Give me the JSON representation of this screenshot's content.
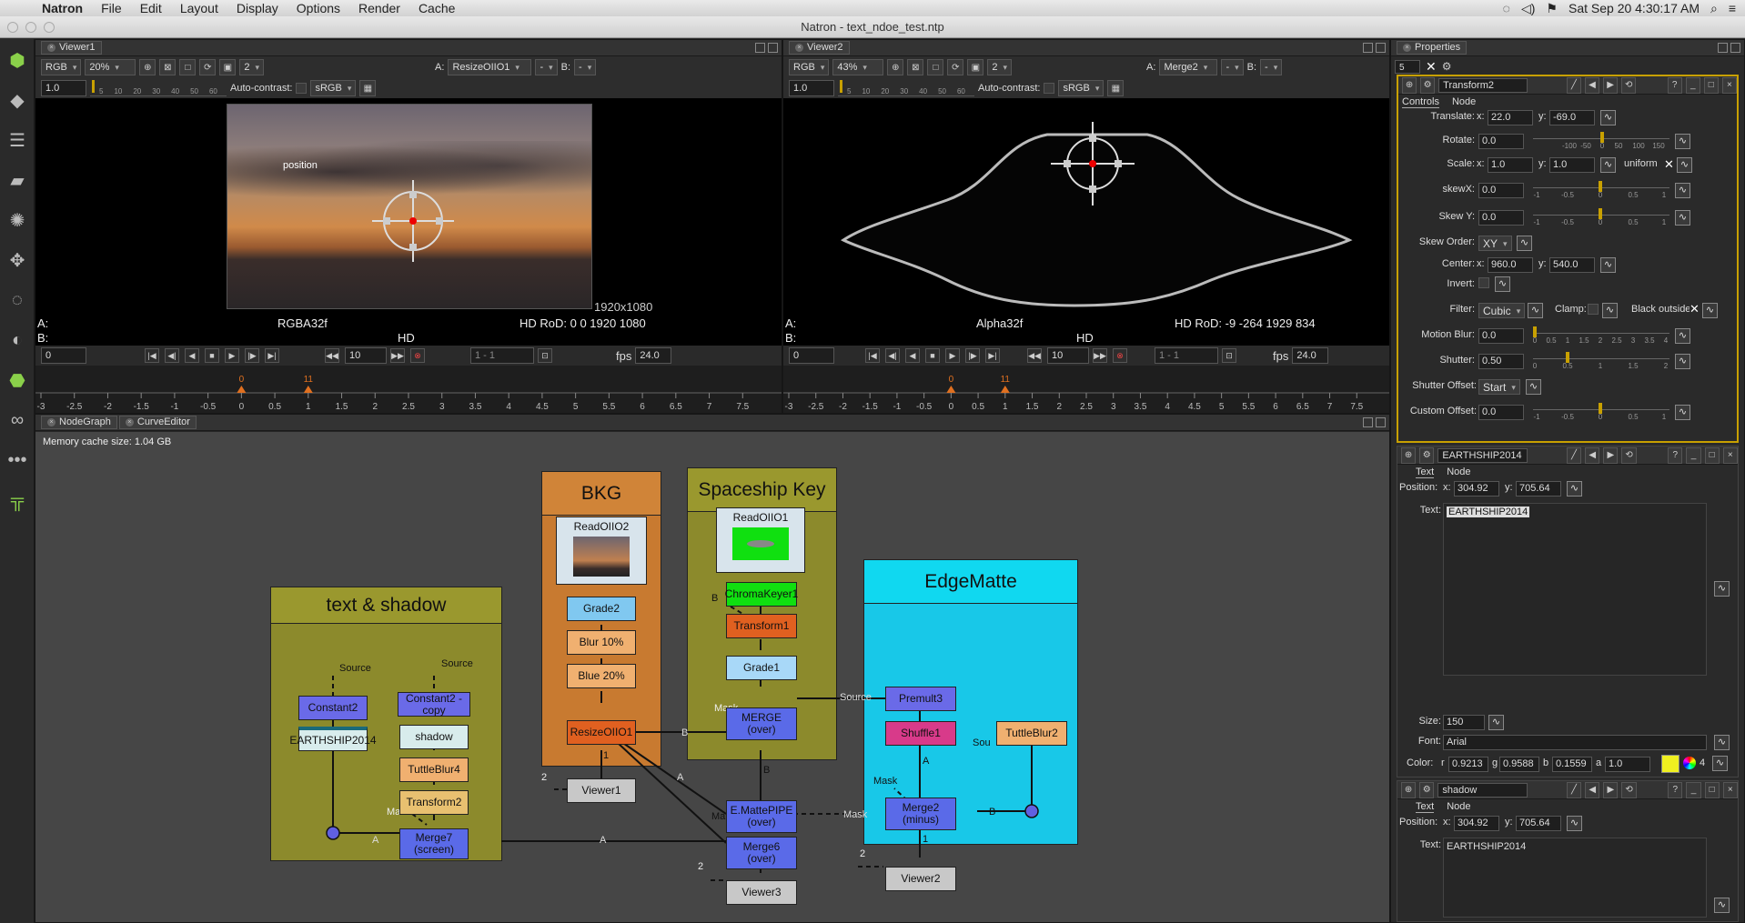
{
  "menubar": {
    "app": "Natron",
    "items": [
      "File",
      "Edit",
      "Layout",
      "Display",
      "Options",
      "Render",
      "Cache"
    ],
    "clock": "Sat Sep 20  4:30:17 AM"
  },
  "window": {
    "title": "Natron - text_ndoe_test.ntp"
  },
  "viewer1": {
    "tab": "Viewer1",
    "channels": "RGB",
    "zoom": "20%",
    "layers": "2",
    "a_label": "A:",
    "a_input": "ResizeOIIO1",
    "a_op": "-",
    "b_label": "B:",
    "b_input": "-",
    "gain": "1.0",
    "autocontrast": "Auto-contrast:",
    "colorspace": "sRGB",
    "gain_ticks": [
      "5",
      "10",
      "20",
      "30",
      "40",
      "50",
      "60"
    ],
    "overlay_text": "position",
    "resolution": "1920x1080",
    "a_info": "A:",
    "b_info": "B:",
    "depth": "RGBA32f",
    "format": "HD",
    "rod": "HD RoD: 0 0 1920 1080",
    "frame": "0",
    "increment": "10",
    "range": "1 - 1",
    "fps_label": "fps",
    "fps": "24.0"
  },
  "viewer2": {
    "tab": "Viewer2",
    "channels": "RGB",
    "zoom": "43%",
    "layers": "2",
    "a_label": "A:",
    "a_input": "Merge2",
    "a_op": "-",
    "b_label": "B:",
    "b_input": "-",
    "gain": "1.0",
    "autocontrast": "Auto-contrast:",
    "colorspace": "sRGB",
    "gain_ticks": [
      "5",
      "10",
      "20",
      "30",
      "40",
      "50",
      "60"
    ],
    "a_info": "A:",
    "b_info": "B:",
    "depth": "Alpha32f",
    "format": "HD",
    "rod": "HD RoD: -9 -264 1929 834",
    "frame": "0",
    "increment": "10",
    "range": "1 - 1",
    "fps_label": "fps",
    "fps": "24.0"
  },
  "timeline": {
    "ticks": [
      "-3",
      "-2.5",
      "-2",
      "-1.5",
      "-1",
      "-0.5",
      "0",
      "0.5",
      "1",
      "1.5",
      "2",
      "2.5",
      "3",
      "3.5",
      "4",
      "4.5",
      "5",
      "5.5",
      "6",
      "6.5",
      "7",
      "7.5"
    ],
    "start": "0",
    "end": "11"
  },
  "nodegraph": {
    "tabs": [
      "NodeGraph",
      "CurveEditor"
    ],
    "cache": "Memory cache size: 1.04 GB",
    "backdrops": {
      "text_shadow": "text & shadow",
      "bkg": "BKG",
      "spaceship": "Spaceship Key",
      "edgematte": "EdgeMatte"
    },
    "nodes": {
      "constant2": "Constant2",
      "earthship": "EARTHSHIP2014",
      "constant2copy": "Constant2 - copy",
      "shadow": "shadow",
      "tuttleblur4": "TuttleBlur4",
      "transform2": "Transform2",
      "merge7": "Merge7\n(screen)",
      "readoiio2": "ReadOIIO2",
      "grade2": "Grade2",
      "blur10": "Blur 10%",
      "blue20": "Blue 20%",
      "resize": "ResizeOIIO1",
      "viewer1": "Viewer1",
      "readoiio1": "ReadOIIO1",
      "chromakeyer": "ChromaKeyer1",
      "transform1": "Transform1",
      "grade1": "Grade1",
      "merge_over": "MERGE\n(over)",
      "emattepipe": "E.MattePIPE\n(over)",
      "merge6": "Merge6\n(over)",
      "viewer3": "Viewer3",
      "premult3": "Premult3",
      "shuffle1": "Shuffle1",
      "tuttleblur2": "TuttleBlur2",
      "merge2": "Merge2\n(minus)",
      "viewer2": "Viewer2"
    },
    "labels": {
      "source": "Source",
      "mask": "Mask",
      "a": "A",
      "b": "B",
      "one": "1",
      "two": "2",
      "ma": "Ma",
      "sou": "Sou"
    }
  },
  "properties": {
    "tab": "Properties",
    "max_panels": "5",
    "transform": {
      "name": "Transform2",
      "tabs": [
        "Controls",
        "Node"
      ],
      "translate_label": "Translate:",
      "tx": "22.0",
      "ty": "-69.0",
      "rotate_label": "Rotate:",
      "rotate": "0.0",
      "rotate_ticks": [
        "-100",
        "-50",
        "0",
        "50",
        "100",
        "150"
      ],
      "scale_label": "Scale:",
      "sx": "1.0",
      "sy": "1.0",
      "uniform": "uniform",
      "skewx_label": "skewX:",
      "skewx": "0.0",
      "skewy_label": "Skew Y:",
      "skewy": "0.0",
      "skew_ticks": [
        "-1",
        "-0.5",
        "0",
        "0.5",
        "1"
      ],
      "skeworder_label": "Skew Order:",
      "skeworder": "XY",
      "center_label": "Center:",
      "cx": "960.0",
      "cy": "540.0",
      "invert_label": "Invert:",
      "filter_label": "Filter:",
      "filter": "Cubic",
      "clamp_label": "Clamp:",
      "black_label": "Black outside",
      "mb_label": "Motion Blur:",
      "mb": "0.0",
      "mb_ticks": [
        "0",
        "0.5",
        "1",
        "1.5",
        "2",
        "2.5",
        "3",
        "3.5",
        "4"
      ],
      "shutter_label": "Shutter:",
      "shutter": "0.50",
      "shutter_ticks": [
        "0",
        "0.5",
        "1",
        "1.5",
        "2"
      ],
      "shutteroffset_label": "Shutter Offset:",
      "shutteroffset": "Start",
      "customoffset_label": "Custom Offset:",
      "customoffset": "0.0"
    },
    "earthship": {
      "name": "EARTHSHIP2014",
      "tabs": [
        "Text",
        "Node"
      ],
      "position_label": "Position:",
      "px": "304.92",
      "py": "705.64",
      "text_label": "Text:",
      "text": "EARTHSHIP2014",
      "size_label": "Size:",
      "size": "150",
      "font_label": "Font:",
      "font": "Arial",
      "color_label": "Color:",
      "r": "0.9213",
      "g": "0.9588",
      "b": "0.1559",
      "a": "1.0",
      "swatch": "#f0f020",
      "dim": "4"
    },
    "shadow": {
      "name": "shadow",
      "tabs": [
        "Text",
        "Node"
      ],
      "position_label": "Position:",
      "px": "304.92",
      "py": "705.64",
      "text_label": "Text:",
      "text": "EARTHSHIP2014"
    }
  },
  "axis_labels": {
    "x": "x:",
    "y": "y:",
    "r": "r",
    "g": "g",
    "b": "b",
    "a": "a"
  },
  "colors": {
    "textbd": "#8c8a2c",
    "bkg": "#c87a30",
    "spaceship": "#8c8a2c",
    "edgematte": "#18c8e8",
    "accent": "#c8a000"
  }
}
